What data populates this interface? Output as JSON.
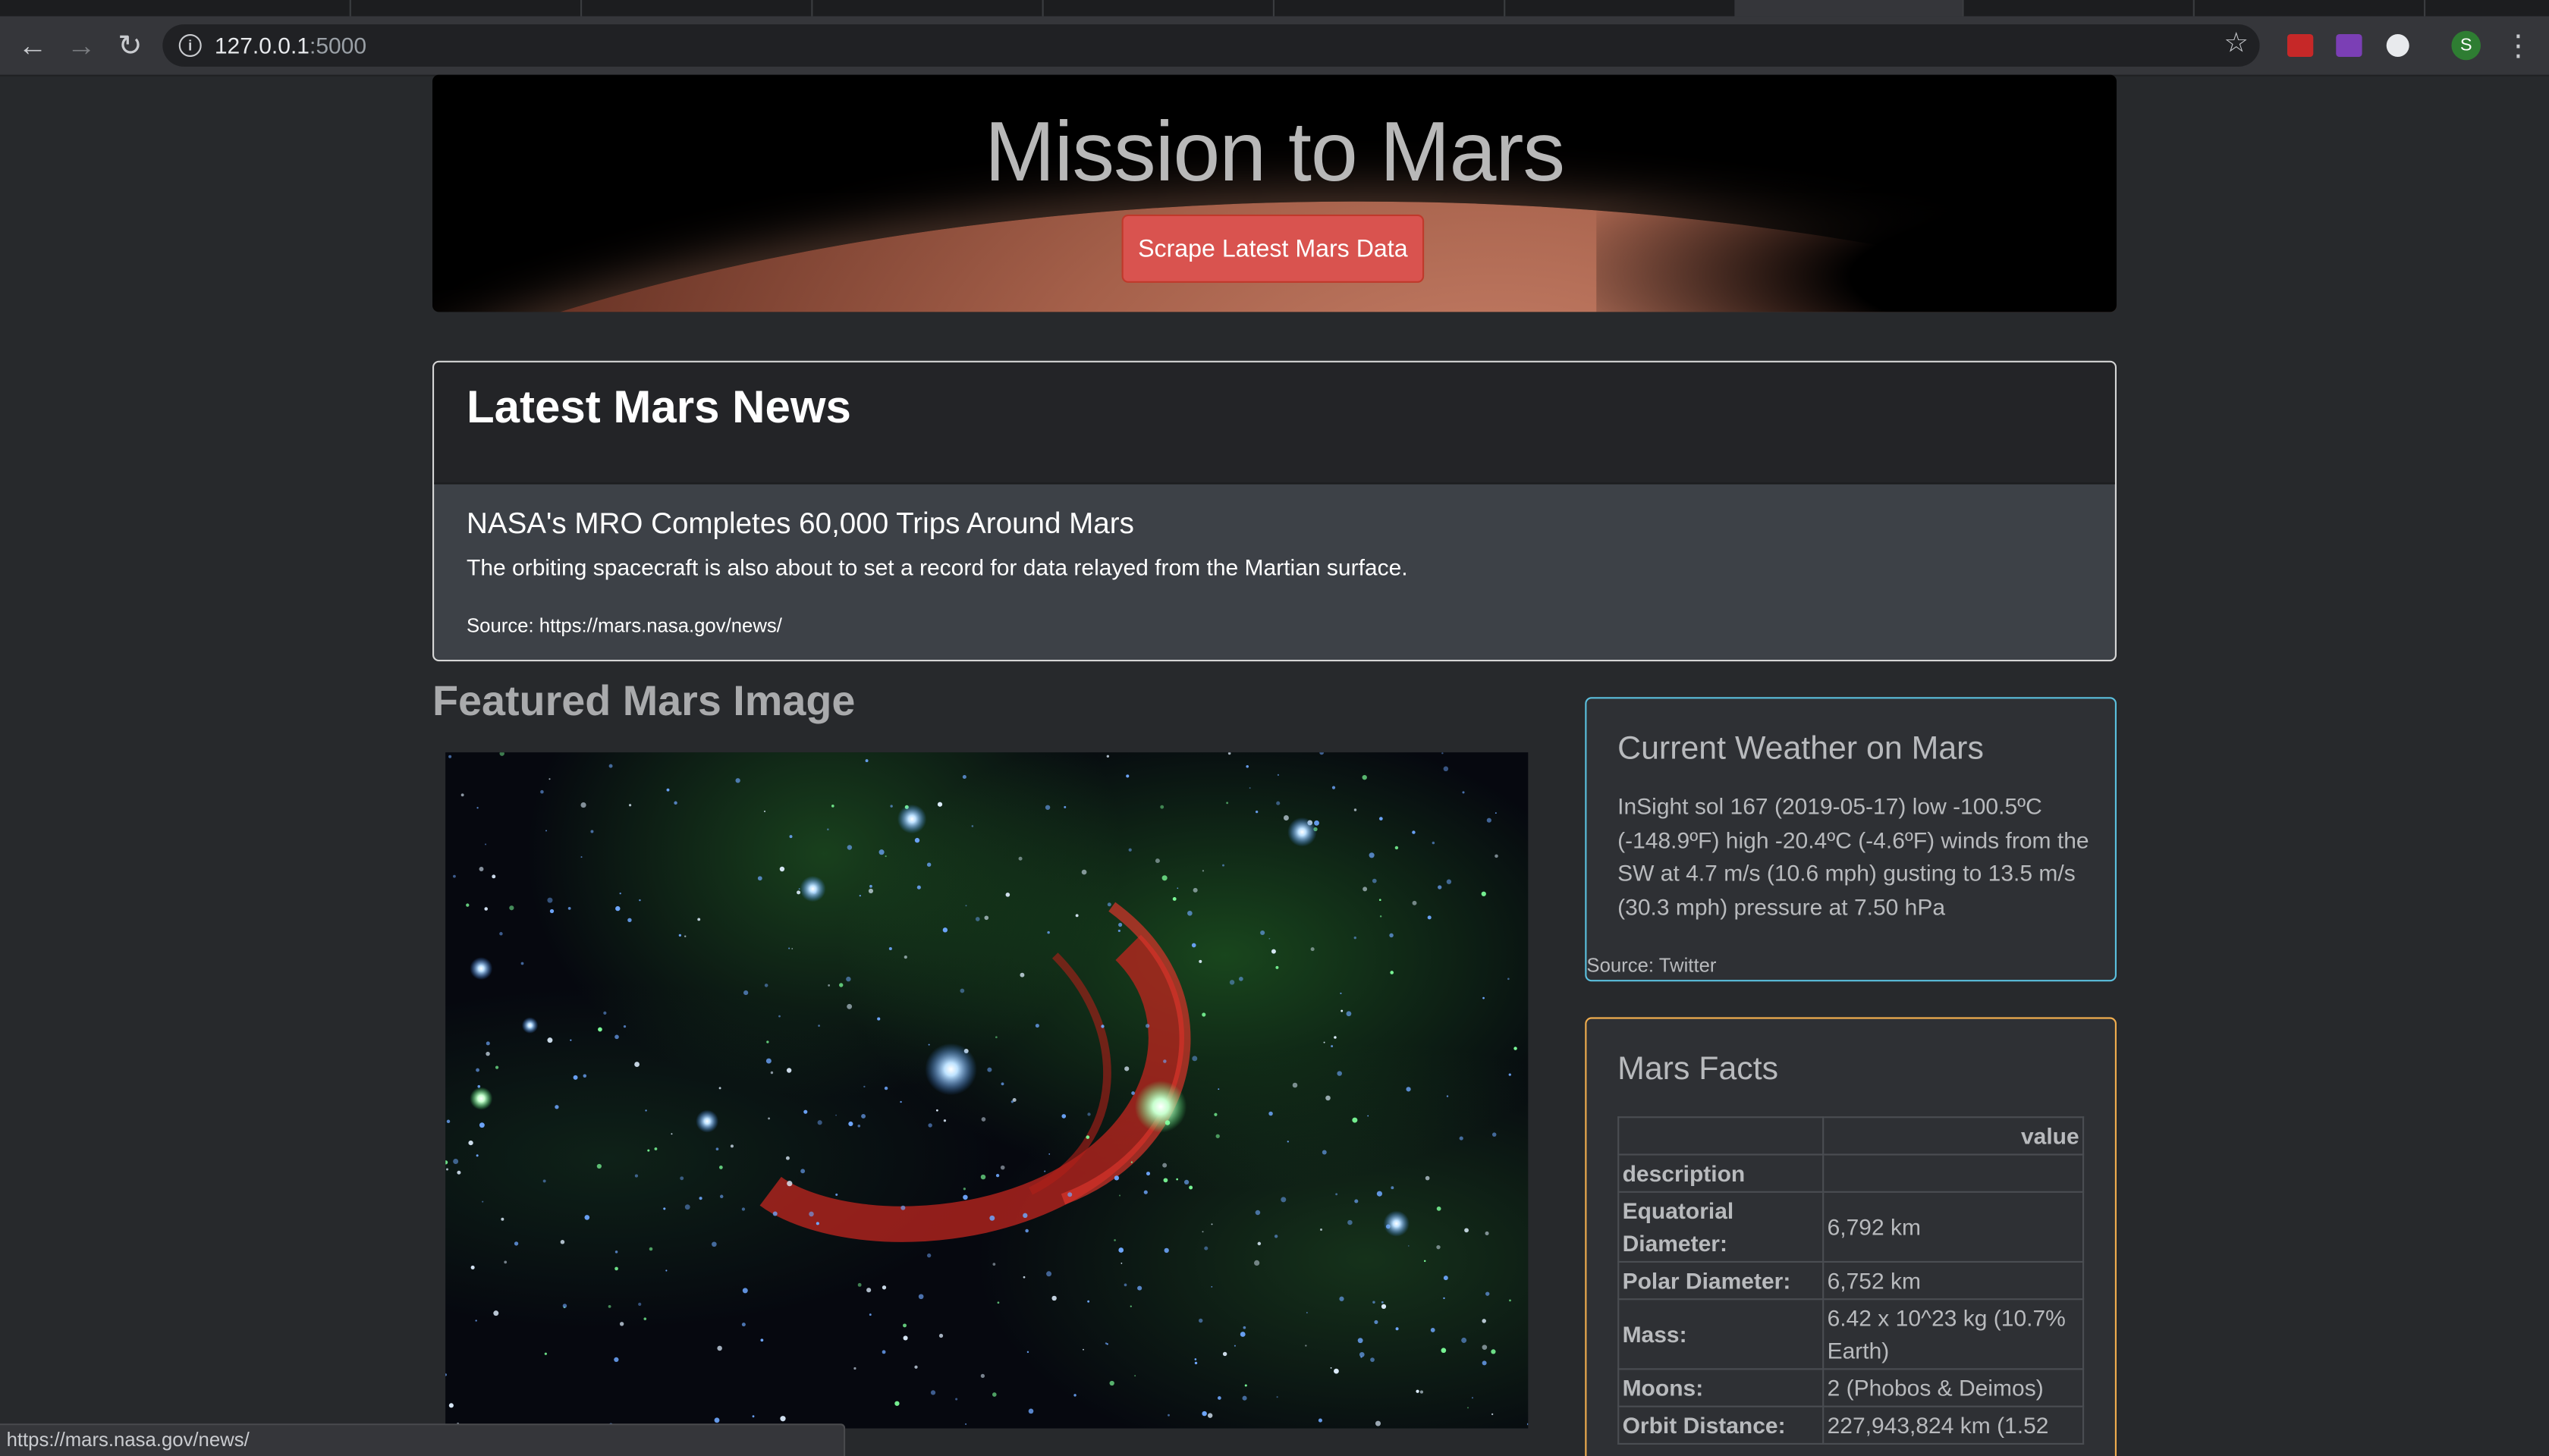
{
  "browser": {
    "url_host": "127.0.0.1",
    "url_port": ":5000",
    "profile_initial": "S",
    "status_url": "https://mars.nasa.gov/news/"
  },
  "jumbotron": {
    "title": "Mission to Mars",
    "scrape_button": "Scrape Latest Mars Data"
  },
  "news": {
    "heading": "Latest Mars News",
    "title": "NASA's MRO Completes 60,000 Trips Around Mars",
    "paragraph": "The orbiting spacecraft is also about to set a record for data relayed from the Martian surface.",
    "source": "Source: https://mars.nasa.gov/news/"
  },
  "featured": {
    "heading": "Featured Mars Image"
  },
  "weather": {
    "heading": "Current Weather on Mars",
    "text": "InSight sol 167 (2019-05-17) low -100.5ºC (-148.9ºF) high -20.4ºC (-4.6ºF) winds from the SW at 4.7 m/s (10.6 mph) gusting to 13.5 m/s (30.3 mph) pressure at 7.50 hPa",
    "source": "Source: Twitter"
  },
  "facts": {
    "heading": "Mars Facts",
    "value_header": "value",
    "index_header": "description",
    "rows": [
      {
        "key": "Equatorial Diameter:",
        "value": "6,792 km"
      },
      {
        "key": "Polar Diameter:",
        "value": "6,752 km"
      },
      {
        "key": "Mass:",
        "value": "6.42 x 10^23 kg (10.7% Earth)"
      },
      {
        "key": "Moons:",
        "value": "2 (Phobos & Deimos)"
      },
      {
        "key": "Orbit Distance:",
        "value": "227,943,824 km (1.52"
      }
    ]
  },
  "colors": {
    "danger": "#d9534f",
    "info": "#5bc0de",
    "warning": "#f0ad4e"
  }
}
